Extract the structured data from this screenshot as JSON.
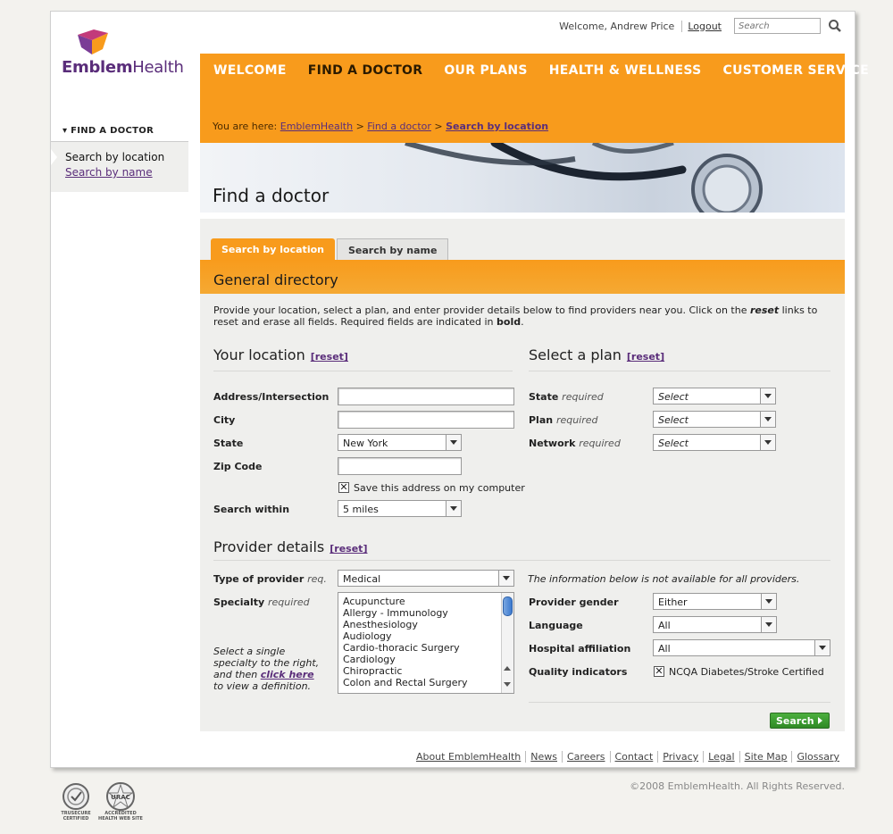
{
  "topbar": {
    "welcome": "Welcome, Andrew Price",
    "logout": "Logout",
    "search_placeholder": "Search"
  },
  "logo": {
    "brand_bold": "Emblem",
    "brand_light": "Health"
  },
  "nav": {
    "items": [
      {
        "label": "WELCOME",
        "active": false
      },
      {
        "label": "FIND A DOCTOR",
        "active": true
      },
      {
        "label": "OUR PLANS",
        "active": false
      },
      {
        "label": "HEALTH & WELLNESS",
        "active": false
      },
      {
        "label": "CUSTOMER SERVICE",
        "active": false
      }
    ],
    "breadcrumb": {
      "prefix": "You are here:",
      "items": [
        "EmblemHealth",
        "Find a doctor",
        "Search by location"
      ],
      "separator": ">"
    }
  },
  "sidebar": {
    "heading": "FIND A DOCTOR",
    "items": [
      {
        "label": "Search by location",
        "active": true
      },
      {
        "label": "Search by name",
        "active": false
      }
    ]
  },
  "hero": {
    "title": "Find a doctor"
  },
  "tabs": [
    {
      "label": "Search by location",
      "active": true
    },
    {
      "label": "Search by name",
      "active": false
    }
  ],
  "general": {
    "title": "General directory",
    "intro_part1": "Provide your location, select a plan, and enter provider details below to find providers near you. Click on the ",
    "intro_reset": "reset",
    "intro_part2": " links to reset and erase all fields. Required fields are indicated in ",
    "intro_bold": "bold",
    "intro_end": "."
  },
  "location": {
    "title": "Your location",
    "reset": "[reset]",
    "address_label": "Address/Intersection",
    "city_label": "City",
    "state_label": "State",
    "state_value": "New York",
    "zip_label": "Zip Code",
    "save_label": "Save this address on my computer",
    "save_checked": true,
    "within_label": "Search within",
    "within_value": "5 miles"
  },
  "plan": {
    "title": "Select a plan",
    "reset": "[reset]",
    "req": "required",
    "state_label": "State",
    "plan_label": "Plan",
    "network_label": "Network",
    "select_value": "Select"
  },
  "provider": {
    "title": "Provider details",
    "reset": "[reset]",
    "type_label": "Type of provider",
    "type_req": "req.",
    "type_value": "Medical",
    "specialty_label": "Specialty",
    "specialty_req": "required",
    "specialties": [
      "Acupuncture",
      "Allergy - Immunology",
      "Anesthesiology",
      "Audiology",
      "Cardio-thoracic Surgery",
      "Cardiology",
      "Chiropractic",
      "Colon and Rectal Surgery"
    ],
    "note_part1": "Select a single specialty to the right, and then ",
    "note_link": "click here",
    "note_part2": " to view a definition.",
    "unavailable_note": "The information below is not available for all providers.",
    "gender_label": "Provider gender",
    "gender_value": "Either",
    "language_label": "Language",
    "language_value": "All",
    "hospital_label": "Hospital affiliation",
    "hospital_value": "All",
    "quality_label": "Quality indicators",
    "quality_option": "NCQA Diabetes/Stroke Certified",
    "quality_checked": true
  },
  "search_button": "Search",
  "footer": {
    "links": [
      "About EmblemHealth",
      "News",
      "Careers",
      "Contact",
      "Privacy",
      "Legal",
      "Site Map",
      "Glossary"
    ],
    "copyright": "©2008 EmblemHealth. All Rights Reserved.",
    "badges": [
      {
        "line1": "TRUSECURE",
        "line2": "CERTIFIED"
      },
      {
        "line1": "URAC",
        "line2": "ACCREDITED",
        "line3": "HEALTH WEB SITE"
      }
    ]
  },
  "colors": {
    "orange": "#f89b1c",
    "purple": "#5a2d7a",
    "green": "#3a9a2e"
  }
}
